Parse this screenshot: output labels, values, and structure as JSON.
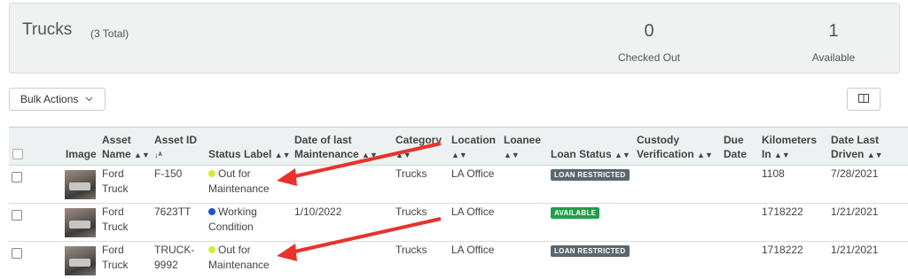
{
  "summary": {
    "title": "Trucks",
    "total": "(3 Total)",
    "stats": [
      {
        "value": "0",
        "label": "Checked Out"
      },
      {
        "value": "1",
        "label": "Available"
      }
    ]
  },
  "toolbar": {
    "bulk_label": "Bulk Actions",
    "chevron": "chevron-down-icon",
    "columns_icon": "columns-icon"
  },
  "table": {
    "headers": {
      "image": "Image",
      "asset_name_1": "Asset",
      "asset_name_2": "Name",
      "asset_id": "Asset ID",
      "status": "Status Label",
      "maint_1": "Date of last",
      "maint_2": "Maintenance",
      "category": "Category",
      "location": "Location",
      "loanee": "Loanee",
      "loan_status": "Loan Status",
      "custody_1": "Custody",
      "custody_2": "Verification",
      "due_1": "Due",
      "due_2": "Date",
      "km_1": "Kilometers",
      "km_2": "In",
      "driven_1": "Date Last",
      "driven_2": "Driven"
    },
    "rows": [
      {
        "name_1": "Ford",
        "name_2": "Truck",
        "id_1": "F-150",
        "id_2": "",
        "status_1": "Out for",
        "status_2": "Maintenance",
        "status_color": "#d4ea3a",
        "maint": "",
        "category": "Trucks",
        "location": "LA Office",
        "loanee": "",
        "loan_status": "LOAN RESTRICTED",
        "loan_color": "#5b6770",
        "custody": "",
        "due": "",
        "km": "1108",
        "driven": "7/28/2021"
      },
      {
        "name_1": "Ford",
        "name_2": "Truck",
        "id_1": "7623TT",
        "id_2": "",
        "status_1": "Working",
        "status_2": "Condition",
        "status_color": "#1f4fd1",
        "maint": "1/10/2022",
        "category": "Trucks",
        "location": "LA Office",
        "loanee": "",
        "loan_status": "AVAILABLE",
        "loan_color": "#1e9e4a",
        "custody": "",
        "due": "",
        "km": "1718222",
        "driven": "1/21/2021"
      },
      {
        "name_1": "Ford",
        "name_2": "Truck",
        "id_1": "TRUCK-",
        "id_2": "9992",
        "status_1": "Out for",
        "status_2": "Maintenance",
        "status_color": "#d4ea3a",
        "maint": "",
        "category": "Trucks",
        "location": "LA Office",
        "loanee": "",
        "loan_status": "LOAN RESTRICTED",
        "loan_color": "#5b6770",
        "custody": "",
        "due": "",
        "km": "1718222",
        "driven": "1/21/2021"
      }
    ]
  },
  "annotation_color": "#e8322c"
}
